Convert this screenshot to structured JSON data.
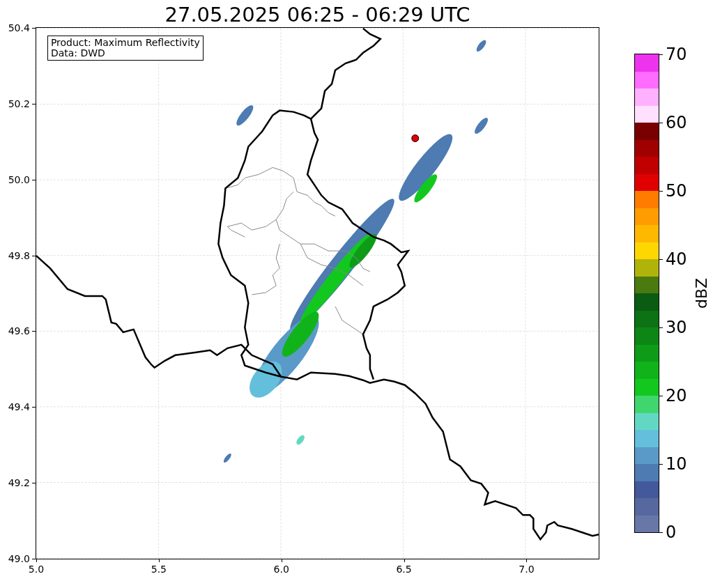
{
  "title": "27.05.2025 06:25 - 06:29 UTC",
  "info_box": [
    "Product: Maximum Reflectivity",
    "Data: DWD"
  ],
  "map": {
    "xticks": [
      "5.0",
      "5.5",
      "6.0",
      "6.5",
      "7.0"
    ],
    "yticks": [
      "50.4",
      "50.2",
      "50.0",
      "49.8",
      "49.6",
      "49.4",
      "49.2",
      "49.0"
    ]
  },
  "colorbar": {
    "label": "dBZ",
    "ticks": [
      "70",
      "60",
      "50",
      "40",
      "30",
      "20",
      "10",
      "0"
    ],
    "bins": [
      {
        "color": "#6777a8"
      },
      {
        "color": "#56689f"
      },
      {
        "color": "#44589c"
      },
      {
        "color": "#4d7bb2"
      },
      {
        "color": "#5a9ac8"
      },
      {
        "color": "#64bfdc"
      },
      {
        "color": "#62d8c4"
      },
      {
        "color": "#3fd66e"
      },
      {
        "color": "#12c81e"
      },
      {
        "color": "#10b41a"
      },
      {
        "color": "#0e9c18"
      },
      {
        "color": "#0d8616"
      },
      {
        "color": "#0c7214"
      },
      {
        "color": "#0a5c12"
      },
      {
        "color": "#4a7a10"
      },
      {
        "color": "#b0b40a"
      },
      {
        "color": "#ffd700"
      },
      {
        "color": "#ffb800"
      },
      {
        "color": "#ff9c00"
      },
      {
        "color": "#ff7c00"
      },
      {
        "color": "#e10000"
      },
      {
        "color": "#c00000"
      },
      {
        "color": "#a00000"
      },
      {
        "color": "#780000"
      },
      {
        "color": "#ffe0ff"
      },
      {
        "color": "#ffb0ff"
      },
      {
        "color": "#ff6cff"
      },
      {
        "color": "#ee33ee"
      }
    ]
  }
}
